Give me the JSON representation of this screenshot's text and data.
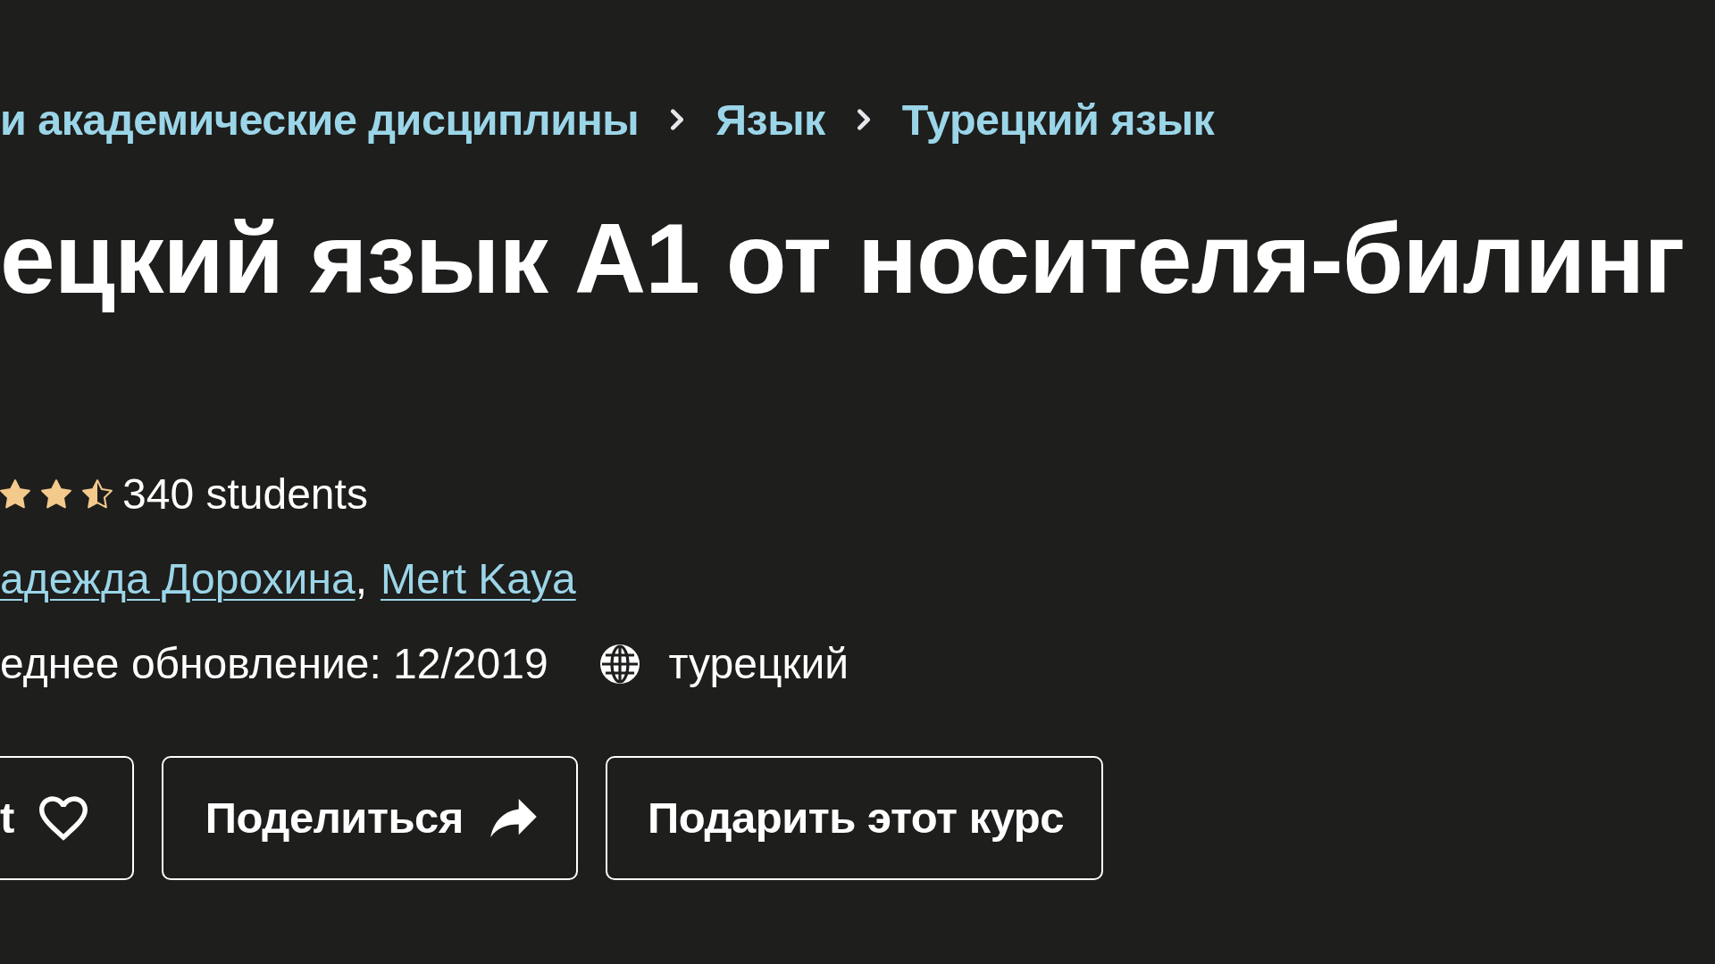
{
  "breadcrumb": [
    {
      "label": "и академические дисциплины"
    },
    {
      "label": "Язык"
    },
    {
      "label": "Турецкий язык"
    }
  ],
  "title": "ецкий язык A1 от носителя-билинг",
  "rating": {
    "stars": 2.5,
    "students": "340 students"
  },
  "instructors": {
    "names": [
      "адежда Дорохина",
      "Mert Kaya"
    ],
    "separator": ","
  },
  "meta": {
    "last_updated": "еднее обновление: 12/2019",
    "language": "турецкий"
  },
  "buttons": [
    {
      "kind": "wishlist",
      "label": "t"
    },
    {
      "kind": "share",
      "label": "Поделиться"
    },
    {
      "kind": "gift",
      "label": "Подарить этот курс"
    }
  ]
}
